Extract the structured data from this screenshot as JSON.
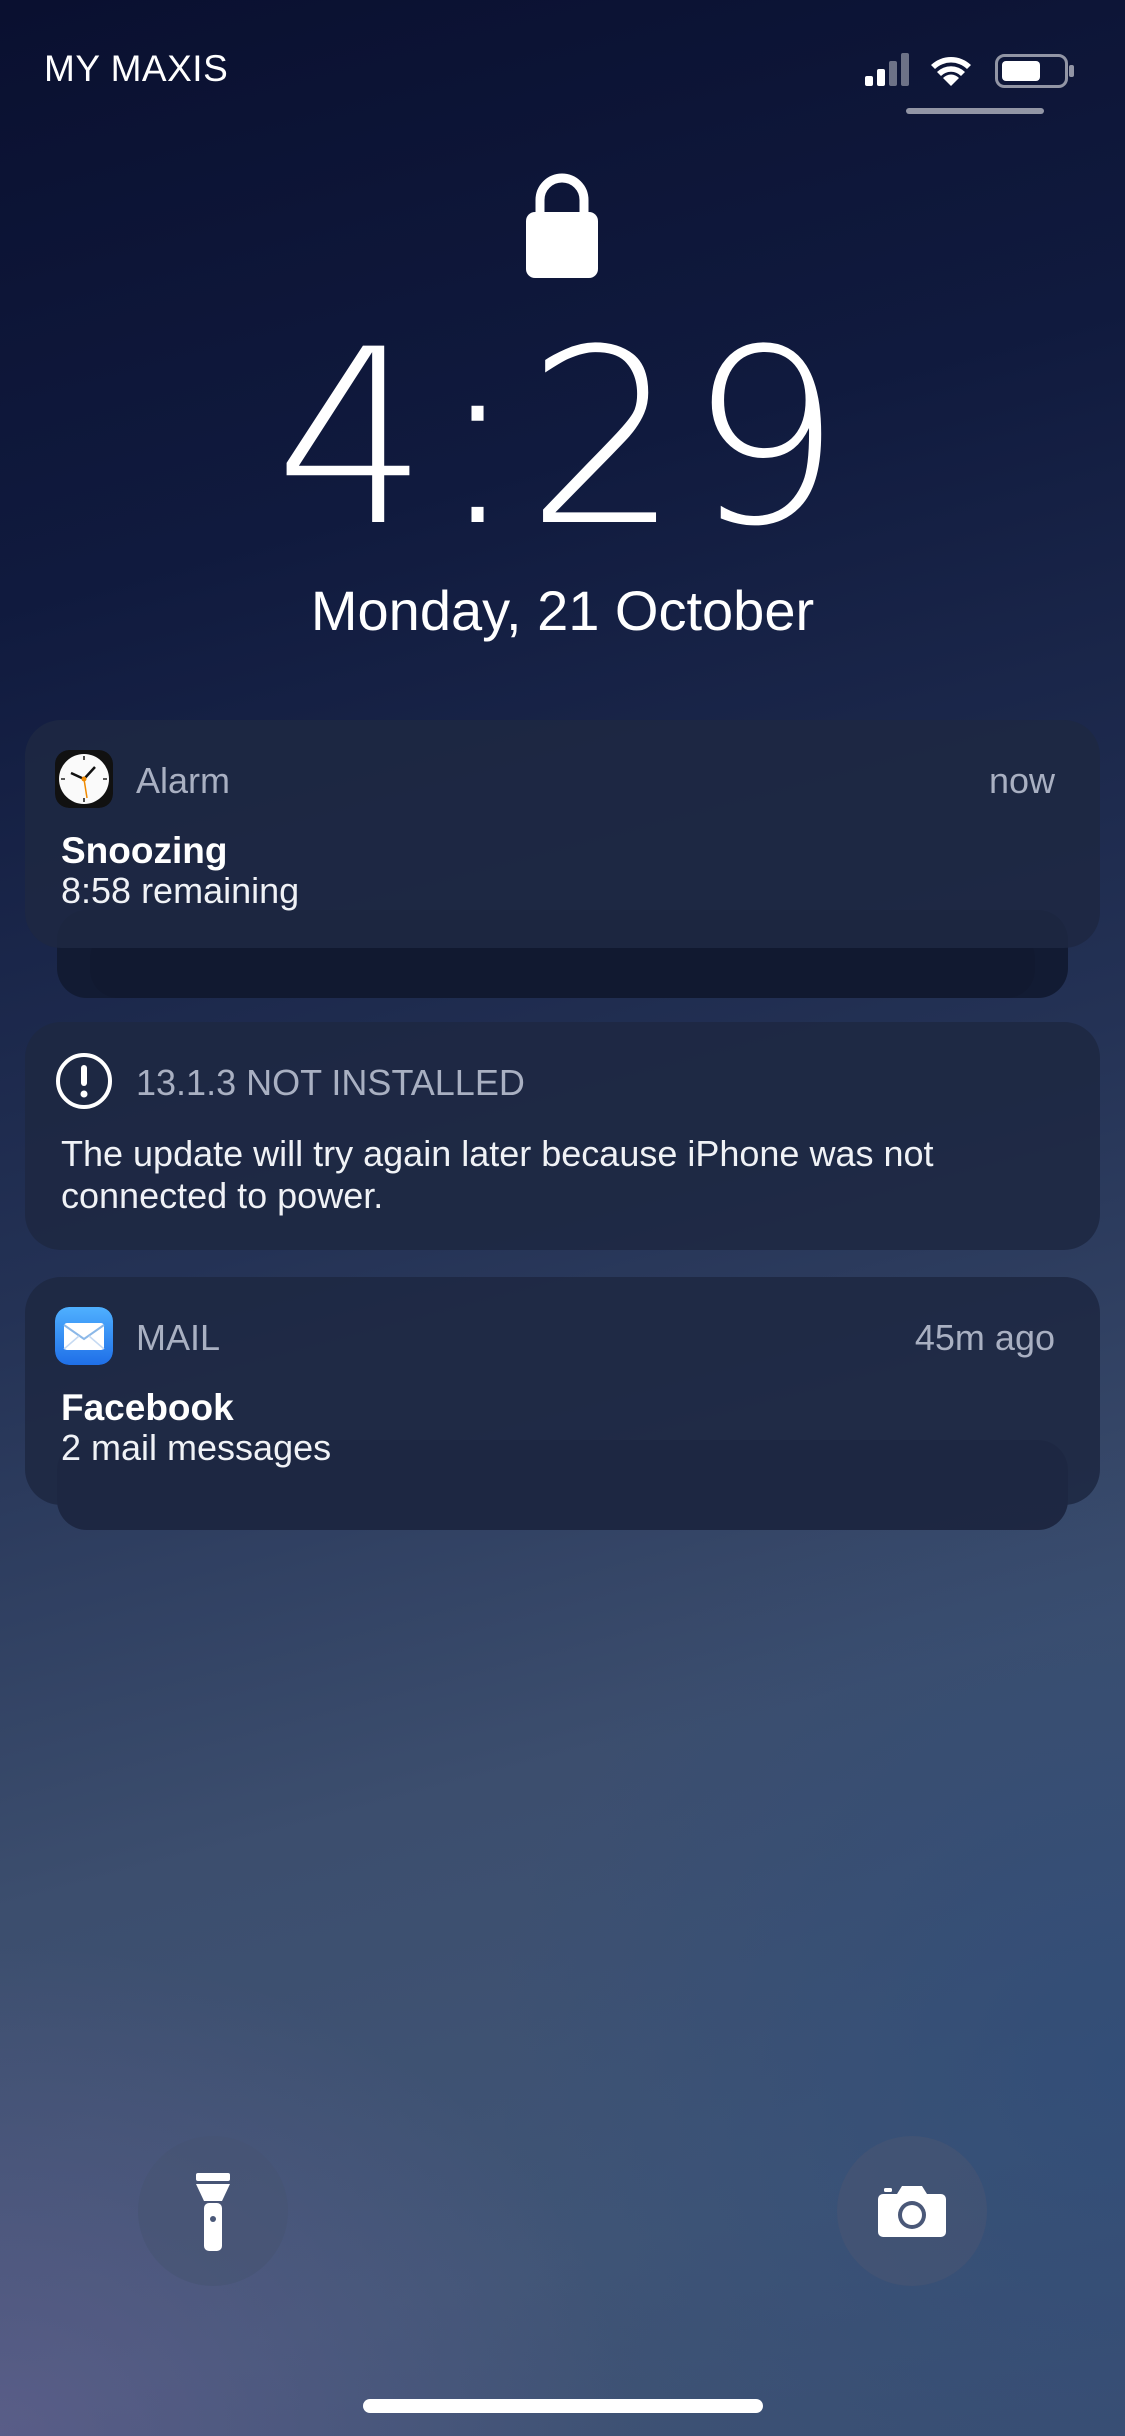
{
  "status_bar": {
    "carrier": "MY MAXIS",
    "icons": [
      "cellular-signal-icon",
      "wifi-icon",
      "battery-icon"
    ]
  },
  "lock_screen": {
    "lock_icon": "lock-icon",
    "time": "4:29",
    "date": "Monday, 21 October"
  },
  "notifications": [
    {
      "app": "Alarm",
      "icon": "clock-icon",
      "time": "now",
      "title": "Snoozing",
      "body": "8:58 remaining",
      "stacked": true
    },
    {
      "app": "13.1.3 NOT INSTALLED",
      "icon": "exclamation-icon",
      "time": "",
      "title": "",
      "body": "The update will try again later because iPhone was not connected to power.",
      "stacked": false
    },
    {
      "app": "MAIL",
      "icon": "mail-icon",
      "time": "45m ago",
      "title": "Facebook",
      "body": "2 mail messages",
      "stacked": true
    }
  ],
  "quick_actions": {
    "left": "flashlight-icon",
    "right": "camera-icon"
  },
  "colors": {
    "card_background": "#1e2842",
    "secondary_text": "#a9b0c2",
    "mail_blue": "#2f8cf4"
  }
}
